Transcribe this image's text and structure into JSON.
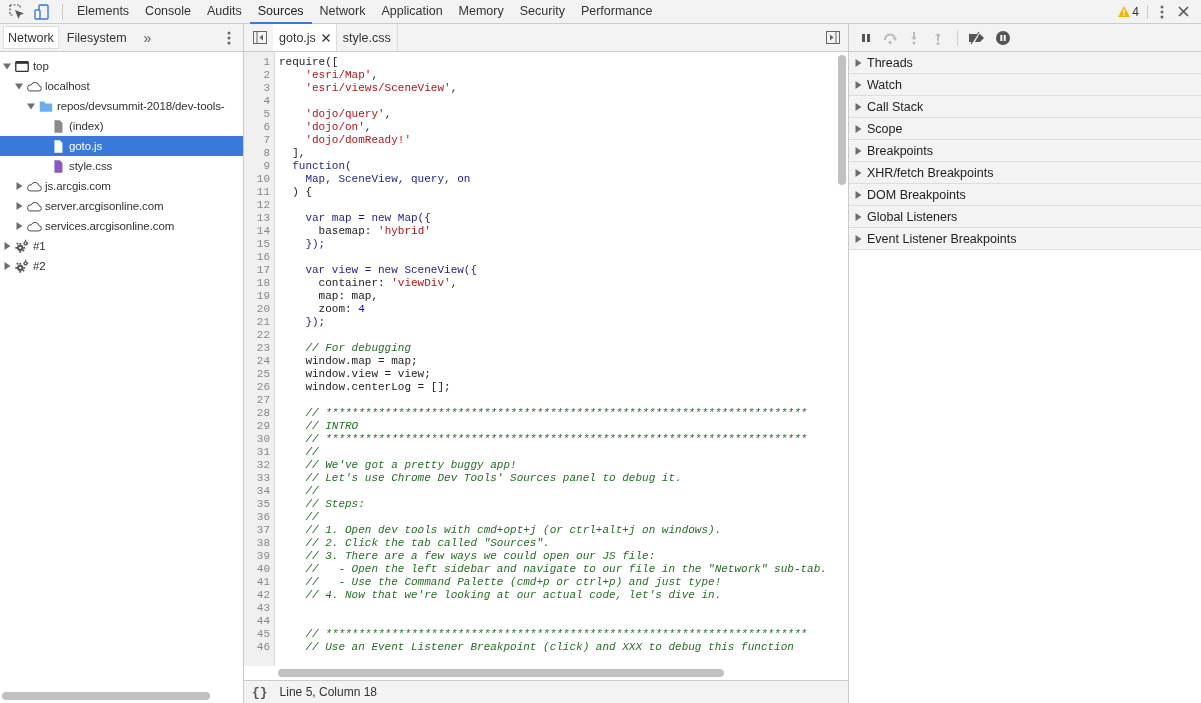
{
  "toolbar": {
    "tabs": [
      {
        "label": "Elements",
        "selected": false
      },
      {
        "label": "Console",
        "selected": false
      },
      {
        "label": "Audits",
        "selected": false
      },
      {
        "label": "Sources",
        "selected": true
      },
      {
        "label": "Network",
        "selected": false
      },
      {
        "label": "Application",
        "selected": false
      },
      {
        "label": "Memory",
        "selected": false
      },
      {
        "label": "Security",
        "selected": false
      },
      {
        "label": "Performance",
        "selected": false
      }
    ],
    "warning_count": "4"
  },
  "navigator": {
    "tabs": [
      {
        "label": "Network",
        "selected": true
      },
      {
        "label": "Filesystem",
        "selected": false
      }
    ],
    "more": "»",
    "tree": [
      {
        "label": "top",
        "kind": "frame",
        "expanded": true,
        "selected": false,
        "children": [
          {
            "label": "localhost",
            "kind": "domain",
            "expanded": true,
            "selected": false,
            "children": [
              {
                "label": "repos/devsummit-2018/dev-tools-",
                "kind": "folder",
                "expanded": true,
                "selected": false,
                "children": [
                  {
                    "label": "(index)",
                    "kind": "document",
                    "selected": false
                  },
                  {
                    "label": "goto.js",
                    "kind": "script",
                    "selected": true
                  },
                  {
                    "label": "style.css",
                    "kind": "stylesheet",
                    "selected": false
                  }
                ]
              }
            ]
          },
          {
            "label": "js.arcgis.com",
            "kind": "domain",
            "expanded": false,
            "selected": false
          },
          {
            "label": "server.arcgisonline.com",
            "kind": "domain",
            "expanded": false,
            "selected": false
          },
          {
            "label": "services.arcgisonline.com",
            "kind": "domain",
            "expanded": false,
            "selected": false
          }
        ]
      },
      {
        "label": "#1",
        "kind": "worker",
        "expanded": false,
        "selected": false
      },
      {
        "label": "#2",
        "kind": "worker",
        "expanded": false,
        "selected": false
      }
    ]
  },
  "editor": {
    "tabs": [
      {
        "label": "goto.js",
        "selected": true
      },
      {
        "label": "style.css",
        "selected": false
      }
    ],
    "lines": [
      {
        "n": "1",
        "tokens": [
          {
            "kind": "plain",
            "text": "require(["
          }
        ]
      },
      {
        "n": "2",
        "tokens": [
          {
            "kind": "string",
            "text": "    'esri/Map'"
          },
          {
            "kind": "plain",
            "text": ","
          }
        ]
      },
      {
        "n": "3",
        "tokens": [
          {
            "kind": "string",
            "text": "    'esri/views/SceneView'"
          },
          {
            "kind": "plain",
            "text": ","
          }
        ]
      },
      {
        "n": "4"
      },
      {
        "n": "5",
        "tokens": [
          {
            "kind": "string",
            "text": "    'dojo/query'"
          },
          {
            "kind": "plain",
            "text": ","
          }
        ]
      },
      {
        "n": "6",
        "tokens": [
          {
            "kind": "string",
            "text": "    'dojo/on'"
          },
          {
            "kind": "plain",
            "text": ","
          }
        ]
      },
      {
        "n": "7",
        "tokens": [
          {
            "kind": "string",
            "text": "    'dojo/domReady!'"
          }
        ]
      },
      {
        "n": "8",
        "tokens": [
          {
            "kind": "plain",
            "text": "  ],"
          }
        ]
      },
      {
        "n": "9",
        "tokens": [
          {
            "kind": "keyword",
            "text": "  function("
          }
        ]
      },
      {
        "n": "10",
        "tokens": [
          {
            "kind": "keyword",
            "text": "    Map, SceneView, query, on"
          }
        ]
      },
      {
        "n": "11",
        "tokens": [
          {
            "kind": "plain",
            "text": "  ) {"
          }
        ]
      },
      {
        "n": "12"
      },
      {
        "n": "13",
        "tokens": [
          {
            "kind": "keyword",
            "text": "    var map = new Map({"
          }
        ]
      },
      {
        "n": "14",
        "tokens": [
          {
            "kind": "plain",
            "text": "      basemap: "
          },
          {
            "kind": "string",
            "text": "'hybrid'"
          }
        ]
      },
      {
        "n": "15",
        "tokens": [
          {
            "kind": "keyword",
            "text": "    });"
          }
        ]
      },
      {
        "n": "16"
      },
      {
        "n": "17",
        "tokens": [
          {
            "kind": "keyword",
            "text": "    var view = new SceneView({"
          }
        ]
      },
      {
        "n": "18",
        "tokens": [
          {
            "kind": "plain",
            "text": "      container: "
          },
          {
            "kind": "string",
            "text": "'viewDiv'"
          },
          {
            "kind": "plain",
            "text": ","
          }
        ]
      },
      {
        "n": "19",
        "tokens": [
          {
            "kind": "plain",
            "text": "      map: map,"
          }
        ]
      },
      {
        "n": "20",
        "tokens": [
          {
            "kind": "plain",
            "text": "      zoom: "
          },
          {
            "kind": "number",
            "text": "4"
          }
        ]
      },
      {
        "n": "21",
        "tokens": [
          {
            "kind": "keyword",
            "text": "    });"
          }
        ]
      },
      {
        "n": "22"
      },
      {
        "n": "23",
        "tokens": [
          {
            "kind": "comment",
            "text": "    // For debugging"
          }
        ]
      },
      {
        "n": "24",
        "tokens": [
          {
            "kind": "plain",
            "text": "    window.map = map;"
          }
        ]
      },
      {
        "n": "25",
        "tokens": [
          {
            "kind": "plain",
            "text": "    window.view = view;"
          }
        ]
      },
      {
        "n": "26",
        "tokens": [
          {
            "kind": "plain",
            "text": "    window.centerLog = [];"
          }
        ]
      },
      {
        "n": "27"
      },
      {
        "n": "28",
        "tokens": [
          {
            "kind": "comment",
            "text": "    // *************************************************************************"
          }
        ]
      },
      {
        "n": "29",
        "tokens": [
          {
            "kind": "comment",
            "text": "    // INTRO"
          }
        ]
      },
      {
        "n": "30",
        "tokens": [
          {
            "kind": "comment",
            "text": "    // *************************************************************************"
          }
        ]
      },
      {
        "n": "31",
        "tokens": [
          {
            "kind": "comment",
            "text": "    //"
          }
        ]
      },
      {
        "n": "32",
        "tokens": [
          {
            "kind": "comment",
            "text": "    // We've got a pretty buggy app!"
          }
        ]
      },
      {
        "n": "33",
        "tokens": [
          {
            "kind": "comment",
            "text": "    // Let's use Chrome Dev Tools' Sources panel to debug it."
          }
        ]
      },
      {
        "n": "34",
        "tokens": [
          {
            "kind": "comment",
            "text": "    //"
          }
        ]
      },
      {
        "n": "35",
        "tokens": [
          {
            "kind": "comment",
            "text": "    // Steps:"
          }
        ]
      },
      {
        "n": "36",
        "tokens": [
          {
            "kind": "comment",
            "text": "    //"
          }
        ]
      },
      {
        "n": "37",
        "tokens": [
          {
            "kind": "comment",
            "text": "    // 1. Open dev tools with cmd+opt+j (or ctrl+alt+j on windows)."
          }
        ]
      },
      {
        "n": "38",
        "tokens": [
          {
            "kind": "comment",
            "text": "    // 2. Click the tab called \"Sources\"."
          }
        ]
      },
      {
        "n": "39",
        "tokens": [
          {
            "kind": "comment",
            "text": "    // 3. There are a few ways we could open our JS file:"
          }
        ]
      },
      {
        "n": "40",
        "tokens": [
          {
            "kind": "comment",
            "text": "    //   - Open the left sidebar and navigate to our file in the \"Network\" sub-tab."
          }
        ]
      },
      {
        "n": "41",
        "tokens": [
          {
            "kind": "comment",
            "text": "    //   - Use the Command Palette (cmd+p or ctrl+p) and just type!"
          }
        ]
      },
      {
        "n": "42",
        "tokens": [
          {
            "kind": "comment",
            "text": "    // 4. Now that we're looking at our actual code, let's dive in."
          }
        ]
      },
      {
        "n": "43"
      },
      {
        "n": "44"
      },
      {
        "n": "45",
        "tokens": [
          {
            "kind": "comment",
            "text": "    // *************************************************************************"
          }
        ]
      },
      {
        "n": "46",
        "tokens": [
          {
            "kind": "comment",
            "text": "    // Use an Event Listener Breakpoint (click) and XXX to debug this function"
          }
        ]
      }
    ],
    "status": {
      "pretty_print": "{}",
      "position": "Line 5, Column 18"
    }
  },
  "debugger": {
    "sections": [
      {
        "label": "Threads",
        "expanded": false
      },
      {
        "label": "Watch",
        "expanded": false
      },
      {
        "label": "Call Stack",
        "expanded": false
      },
      {
        "label": "Scope",
        "expanded": false
      },
      {
        "label": "Breakpoints",
        "expanded": false
      },
      {
        "label": "XHR/fetch Breakpoints",
        "expanded": false
      },
      {
        "label": "DOM Breakpoints",
        "expanded": false
      },
      {
        "label": "Global Listeners",
        "expanded": false
      },
      {
        "label": "Event Listener Breakpoints",
        "expanded": false
      }
    ]
  }
}
